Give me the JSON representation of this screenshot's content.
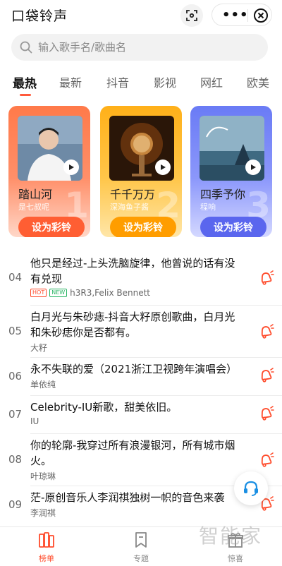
{
  "header": {
    "title": "口袋铃声"
  },
  "search": {
    "placeholder": "输入歌手名/歌曲名"
  },
  "tabs": [
    {
      "label": "最热",
      "active": true
    },
    {
      "label": "最新"
    },
    {
      "label": "抖音"
    },
    {
      "label": "影视"
    },
    {
      "label": "网红"
    },
    {
      "label": "欧美"
    }
  ],
  "featured": [
    {
      "rank": "1",
      "title": "踏山河",
      "artist": "是七叔呢",
      "button": "设为彩铃"
    },
    {
      "rank": "2",
      "title": "千千万万",
      "artist": "深海鱼子酱",
      "button": "设为彩铃"
    },
    {
      "rank": "3",
      "title": "四季予你",
      "artist": "程响",
      "button": "设为彩铃"
    }
  ],
  "songs": [
    {
      "rank": "04",
      "title": "他只是经过-上头洗脑旋律，他曾说的话有没有兑现",
      "artist": "h3R3,Felix Bennett",
      "badges": [
        "HOT",
        "NEW"
      ]
    },
    {
      "rank": "05",
      "title": "白月光与朱砂痣-抖音大籽原创歌曲，白月光和朱砂痣你是否都有。",
      "artist": "大籽"
    },
    {
      "rank": "06",
      "title": "永不失联的爱（2021浙江卫视跨年演唱会）",
      "artist": "单依纯"
    },
    {
      "rank": "07",
      "title": "Celebrity-IU新歌，甜美依旧。",
      "artist": "IU"
    },
    {
      "rank": "08",
      "title": "你的轮廓-我穿过所有浪漫银河，所有城市烟火。",
      "artist": "叶琼琳"
    },
    {
      "rank": "09",
      "title": "茫-原创音乐人李润祺独树一帜的音色来袭",
      "artist": "李润祺"
    }
  ],
  "bottom_nav": [
    {
      "label": "榜单",
      "active": true
    },
    {
      "label": "专题"
    },
    {
      "label": "惊喜"
    }
  ],
  "watermark": "智能家",
  "colors": {
    "accent": "#ff5a3c",
    "card1": "#ff7a4a",
    "card2": "#ffb019",
    "card3": "#6a7bf5"
  }
}
